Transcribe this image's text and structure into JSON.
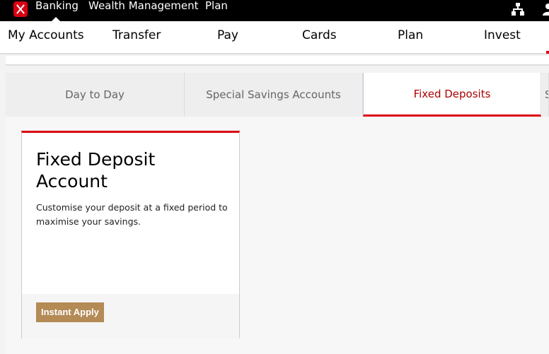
{
  "topbar": {
    "items": [
      "Banking",
      "Wealth Management",
      "Plan"
    ]
  },
  "nav": {
    "items": [
      "My Accounts",
      "Transfer",
      "Pay",
      "Cards",
      "Plan",
      "Invest"
    ]
  },
  "tabs": [
    {
      "label": "Day to Day"
    },
    {
      "label": "Special Savings Accounts"
    },
    {
      "label": "Fixed Deposits",
      "active": true
    },
    {
      "label": "S"
    }
  ],
  "card": {
    "title": "Fixed Deposit Account",
    "description": "Customise your deposit at a fixed period to maximise your savings.",
    "button": "Instant Apply"
  },
  "colors": {
    "brand": "#db0011",
    "button": "#b48a55"
  }
}
